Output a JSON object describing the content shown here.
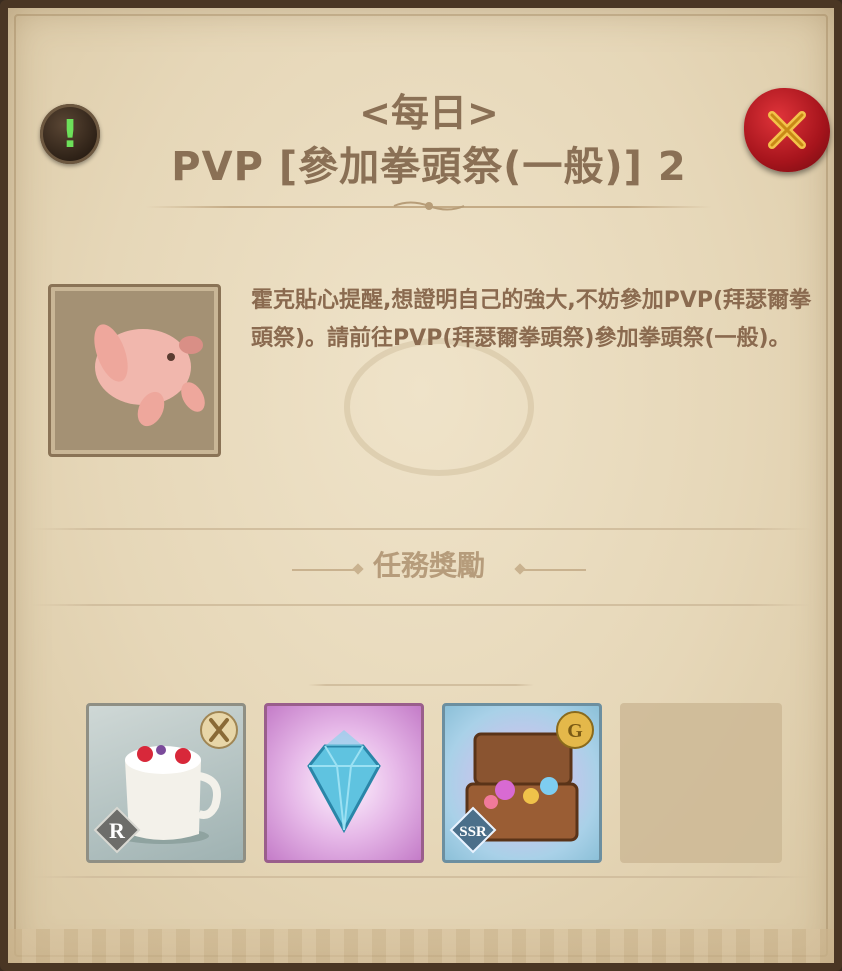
{
  "quest": {
    "category": "<每日>",
    "title": "PVP [參加拳頭祭(一般)] 2",
    "description": "霍克貼心提醒,想證明自己的強大,不妨參加PVP(拜瑟爾拳頭祭)。請前往PVP(拜瑟爾拳頭祭)參加拳頭祭(一般)。",
    "npc_icon": "hawk-pig-portrait"
  },
  "buttons": {
    "info_icon": "!",
    "close_icon": "close-x"
  },
  "rewards": {
    "header": "任務獎勵",
    "items": [
      {
        "icon": "strawberry-milk-cup",
        "rarity": "R",
        "corner": "utensils"
      },
      {
        "icon": "blue-diamond-gem"
      },
      {
        "icon": "treasure-chest",
        "rarity": "SSR",
        "corner": "gold-coin",
        "corner_text": "G"
      },
      {
        "icon": "empty-slot"
      }
    ]
  },
  "colors": {
    "parchment": "#e6d7b8",
    "title_text": "#8a7055",
    "body_text": "#8a6a4f",
    "close_red": "#c0171f",
    "info_green": "#6de05a"
  }
}
